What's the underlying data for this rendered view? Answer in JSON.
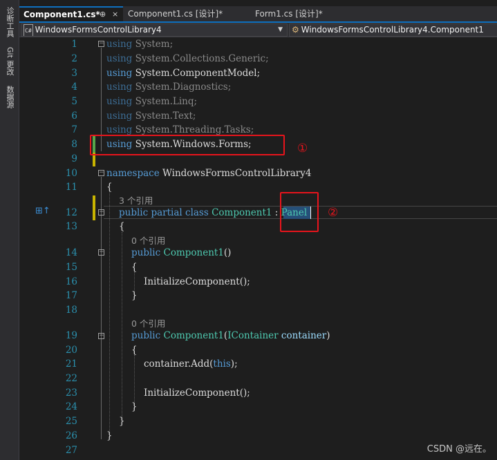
{
  "toolstrip": {
    "items": [
      "诊断工具",
      "Git 更改",
      "数据源"
    ]
  },
  "tabs": [
    {
      "label": "Component1.cs*",
      "pin": "⊕",
      "close": "×"
    },
    {
      "label": "Component1.cs [设计]*"
    },
    {
      "label": "Form1.cs [设计]*"
    }
  ],
  "navbar": {
    "project": "WindowsFormsControlLibrary4",
    "project_icon": "C#-project-icon",
    "member": "WindowsFormsControlLibrary4.Component1",
    "member_icon": "class-icon"
  },
  "editor": {
    "line_numbers": [
      "1",
      "2",
      "3",
      "4",
      "5",
      "6",
      "7",
      "8",
      "9",
      "10",
      "11",
      "12",
      "13",
      "14",
      "15",
      "16",
      "17",
      "18",
      "19",
      "20",
      "21",
      "22",
      "23",
      "24",
      "25",
      "26",
      "27"
    ],
    "codelens": {
      "class_refs": "3 个引用",
      "ctor1_refs": "0 个引用",
      "ctor2_refs": "0 个引用"
    },
    "using_kw": "using",
    "usings": [
      "System;",
      "System.Collections.Generic;",
      "System.ComponentModel;",
      "System.Diagnostics;",
      "System.Linq;",
      "System.Text;",
      "System.Threading.Tasks;",
      "System.Windows.Forms;"
    ],
    "namespace_kw": "namespace",
    "namespace_name": "WindowsFormsControlLibrary4",
    "open_brace": "{",
    "close_brace": "}",
    "class_mods": "public partial class",
    "class_name": "Component1",
    "colon": " : ",
    "base_class": "Panel",
    "public_kw": "public",
    "ctor_name": "Component1",
    "ctor1_params": "()",
    "ctor2_open": "(",
    "ctor2_param_type": "IContainer",
    "ctor2_param_name": "container",
    "ctor2_close": ")",
    "init_call": "InitializeComponent();",
    "add_call_prefix": "container.Add(",
    "this_kw": "this",
    "add_call_suffix": ");"
  },
  "annotations": {
    "circle1": "①",
    "circle2": "②"
  },
  "watermark": "CSDN @远在。",
  "colors": {
    "keyword": "#569cd6",
    "type": "#4ec9b0",
    "line_number": "#2b91af",
    "annotation_red": "#e8141c",
    "accent": "#0e70c0"
  }
}
